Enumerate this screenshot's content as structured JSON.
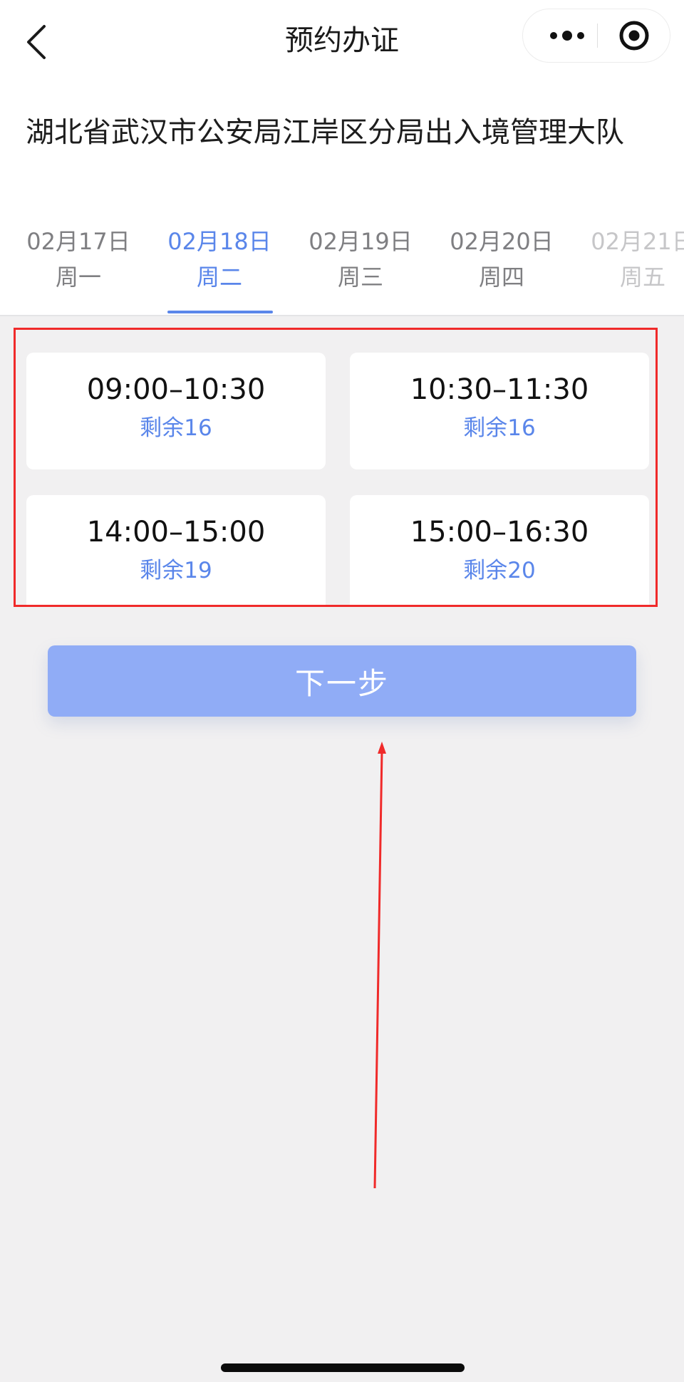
{
  "nav": {
    "title": "预约办证",
    "back_icon": "back-chevron-icon",
    "more_icon": "more-dots-icon",
    "close_icon": "target-close-icon"
  },
  "office_name": "湖北省武汉市公安局江岸区分局出入境管理大队",
  "date_tabs": [
    {
      "date": "02月17日",
      "weekday": "周一"
    },
    {
      "date": "02月18日",
      "weekday": "周二"
    },
    {
      "date": "02月19日",
      "weekday": "周三"
    },
    {
      "date": "02月20日",
      "weekday": "周四"
    },
    {
      "date": "02月21日",
      "weekday": "周五"
    }
  ],
  "selected_tab": 1,
  "time_slots": [
    {
      "time": "09:00–10:30",
      "remaining": "剩余16"
    },
    {
      "time": "10:30–11:30",
      "remaining": "剩余16"
    },
    {
      "time": "14:00–15:00",
      "remaining": "剩余19"
    },
    {
      "time": "15:00–16:30",
      "remaining": "剩余20"
    }
  ],
  "next_button": "下一步",
  "colors": {
    "accent": "#5a86ea",
    "button": "#90acf6",
    "annotation": "#f02a2a",
    "background": "#f1f0f1"
  }
}
